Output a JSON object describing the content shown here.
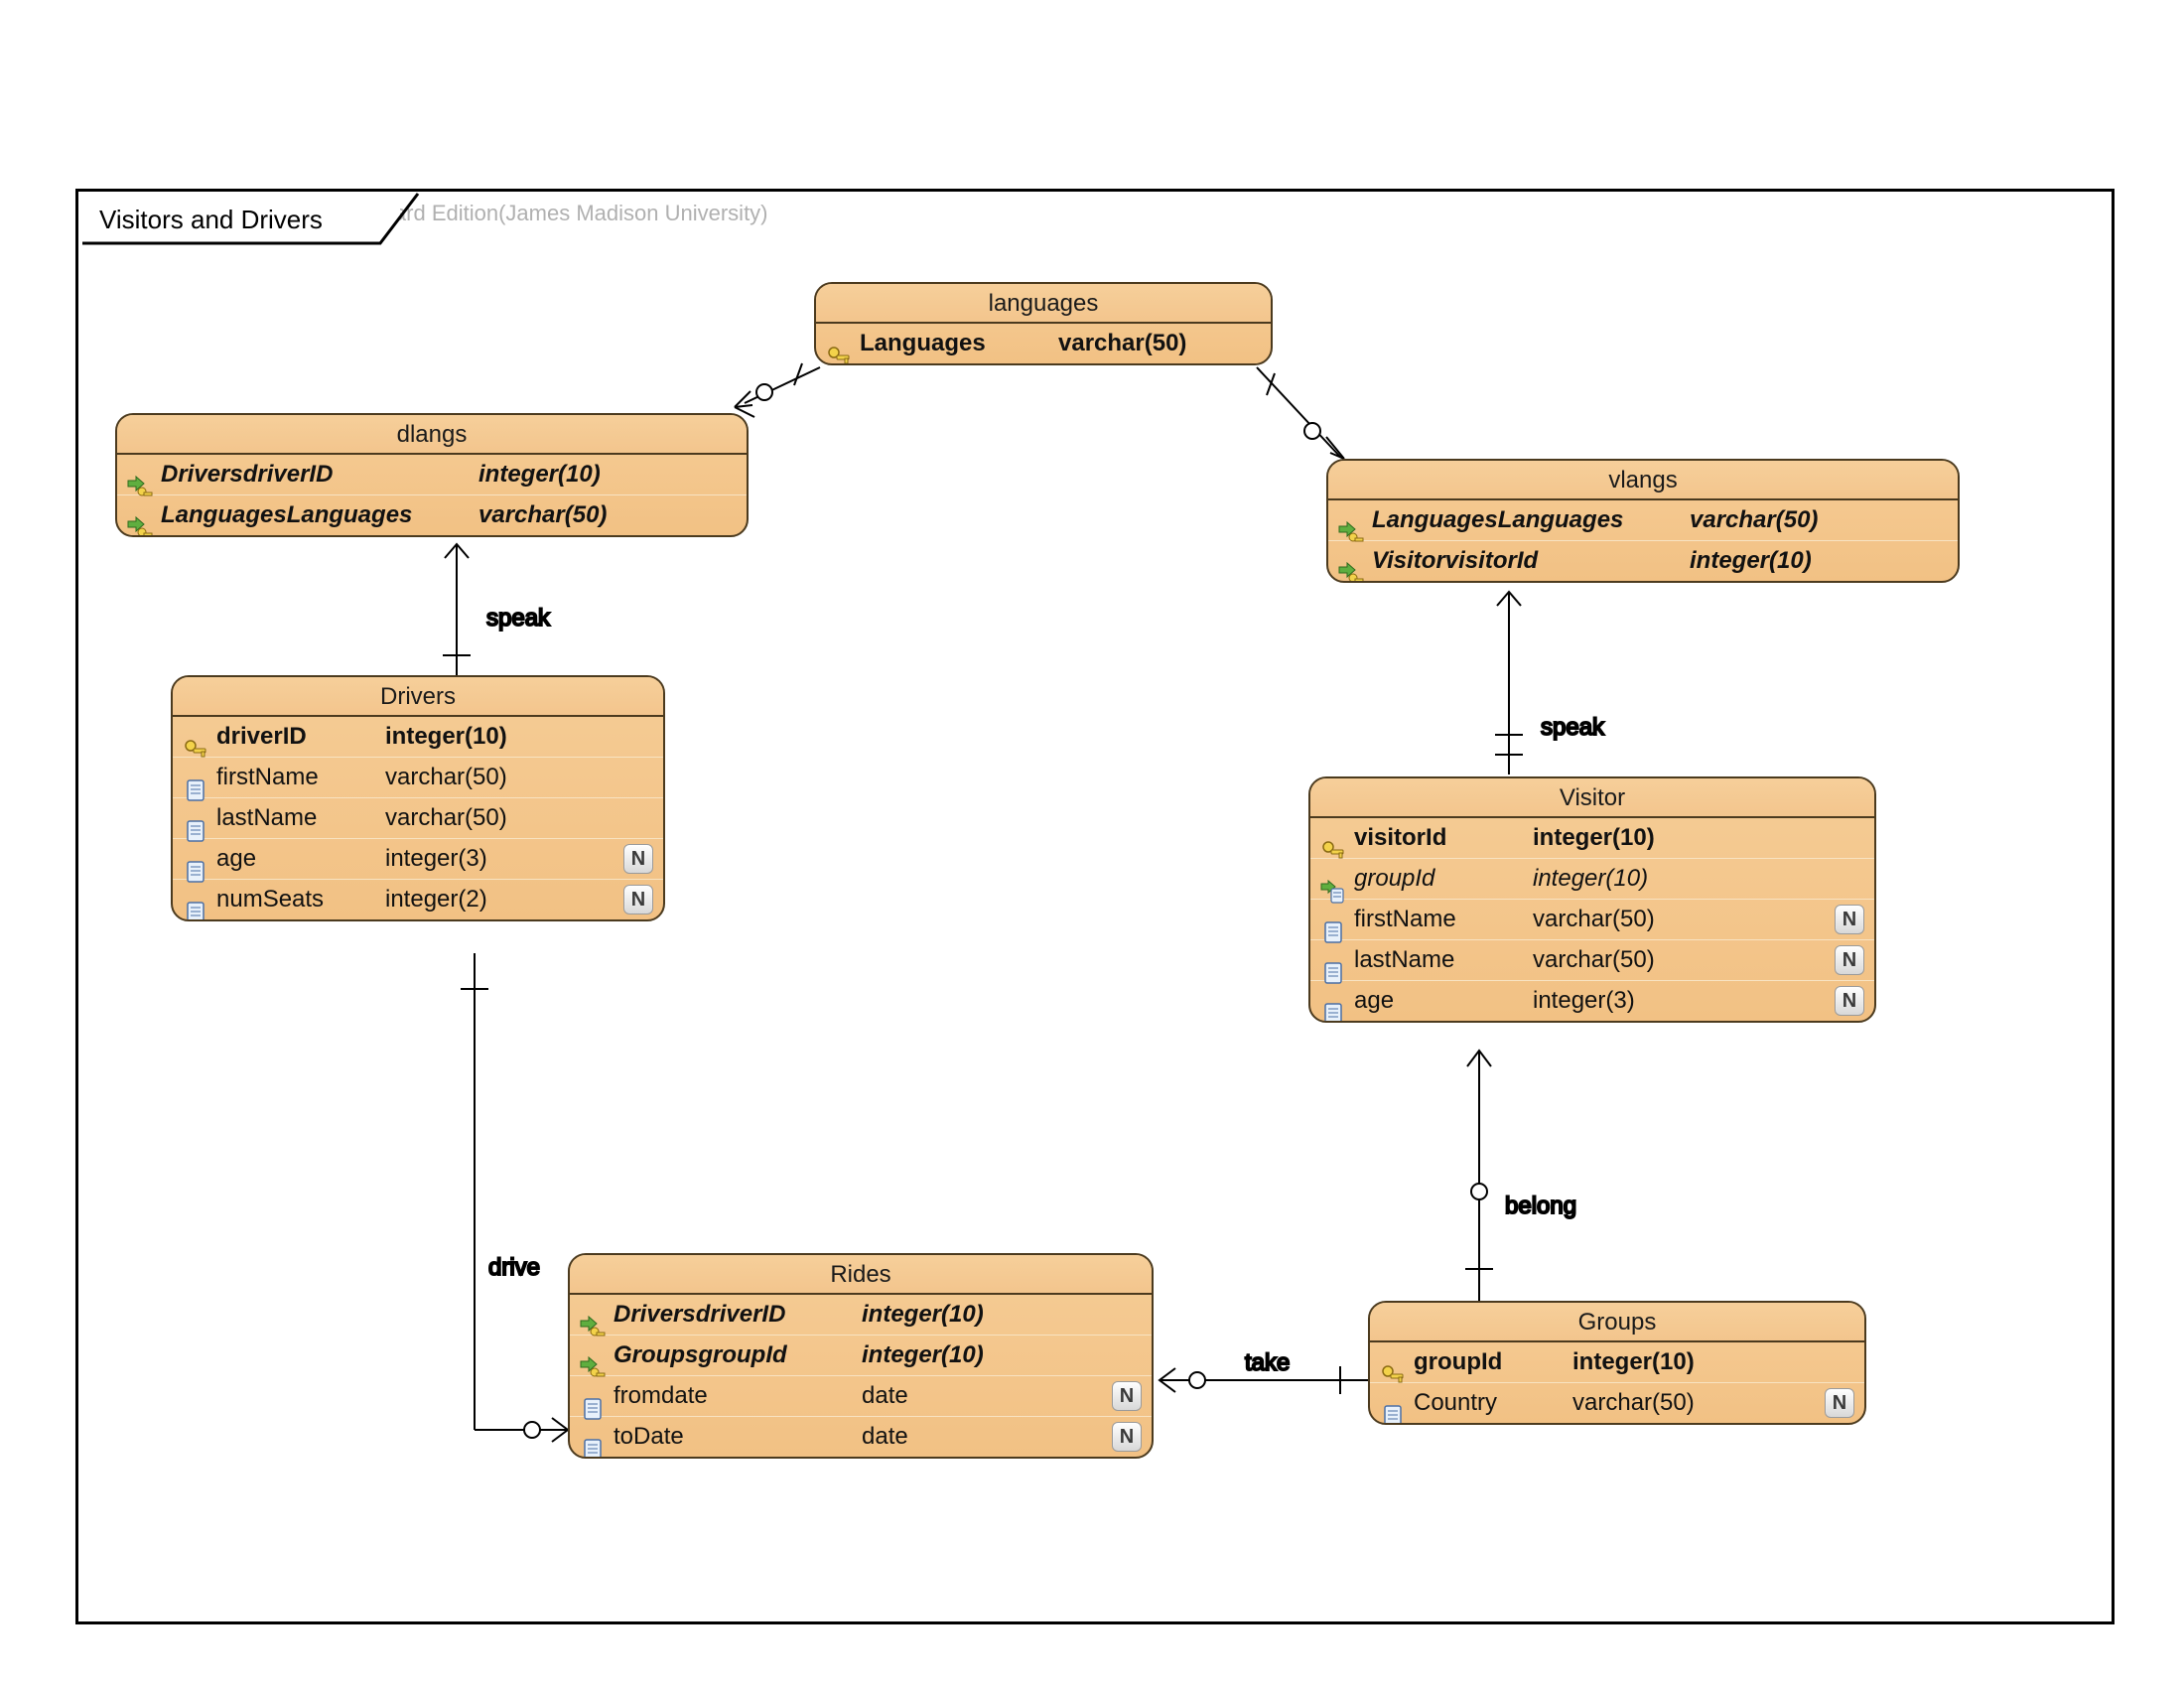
{
  "watermark": "Visual Paradigm for UML Standard Edition(James Madison University)",
  "frame_title": "Visitors and Drivers",
  "labels": {
    "speak1": "speak",
    "speak2": "speak",
    "drive": "drive",
    "take": "take",
    "belong": "belong"
  },
  "entities": {
    "languages": {
      "title": "languages",
      "rows": [
        {
          "icon": "pk",
          "name": "Languages",
          "type": "varchar(50)",
          "bold": true
        }
      ]
    },
    "dlangs": {
      "title": "dlangs",
      "rows": [
        {
          "icon": "fk",
          "name": "DriversdriverID",
          "type": "integer(10)",
          "bold": true,
          "italic": true
        },
        {
          "icon": "fk",
          "name": "LanguagesLanguages",
          "type": "varchar(50)",
          "bold": true,
          "italic": true
        }
      ]
    },
    "vlangs": {
      "title": "vlangs",
      "rows": [
        {
          "icon": "fk",
          "name": "LanguagesLanguages",
          "type": "varchar(50)",
          "bold": true,
          "italic": true
        },
        {
          "icon": "fk",
          "name": "VisitorvisitorId",
          "type": "integer(10)",
          "bold": true,
          "italic": true
        }
      ]
    },
    "drivers": {
      "title": "Drivers",
      "rows": [
        {
          "icon": "pk",
          "name": "driverID",
          "type": "integer(10)",
          "bold": true
        },
        {
          "icon": "col",
          "name": "firstName",
          "type": "varchar(50)"
        },
        {
          "icon": "col",
          "name": "lastName",
          "type": "varchar(50)"
        },
        {
          "icon": "col",
          "name": "age",
          "type": "integer(3)",
          "null": true
        },
        {
          "icon": "col",
          "name": "numSeats",
          "type": "integer(2)",
          "null": true
        }
      ]
    },
    "visitor": {
      "title": "Visitor",
      "rows": [
        {
          "icon": "pk",
          "name": "visitorId",
          "type": "integer(10)",
          "bold": true
        },
        {
          "icon": "fk",
          "name": "groupId",
          "type": "integer(10)",
          "italic": true
        },
        {
          "icon": "col",
          "name": "firstName",
          "type": "varchar(50)",
          "null": true
        },
        {
          "icon": "col",
          "name": "lastName",
          "type": "varchar(50)",
          "null": true
        },
        {
          "icon": "col",
          "name": "age",
          "type": "integer(3)",
          "null": true
        }
      ]
    },
    "rides": {
      "title": "Rides",
      "rows": [
        {
          "icon": "fk",
          "name": "DriversdriverID",
          "type": "integer(10)",
          "bold": true,
          "italic": true
        },
        {
          "icon": "fk",
          "name": "GroupsgroupId",
          "type": "integer(10)",
          "bold": true,
          "italic": true
        },
        {
          "icon": "col",
          "name": "fromdate",
          "type": "date",
          "null": true
        },
        {
          "icon": "col",
          "name": "toDate",
          "type": "date",
          "null": true
        }
      ]
    },
    "groups": {
      "title": "Groups",
      "rows": [
        {
          "icon": "pk",
          "name": "groupId",
          "type": "integer(10)",
          "bold": true
        },
        {
          "icon": "col",
          "name": "Country",
          "type": "varchar(50)",
          "null": true
        }
      ]
    }
  }
}
